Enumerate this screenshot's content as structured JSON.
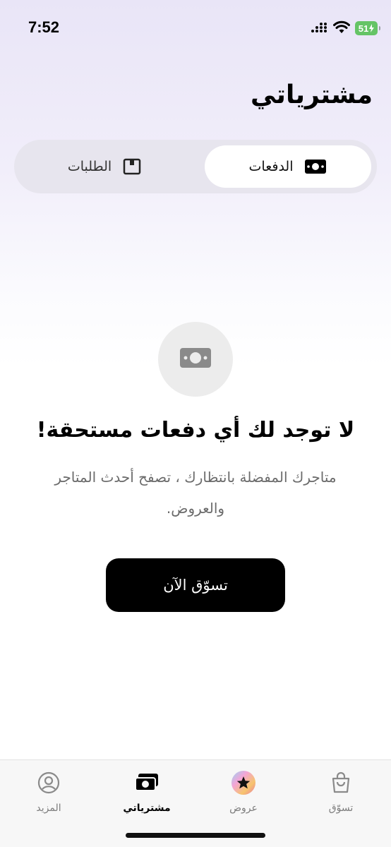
{
  "status_bar": {
    "time": "7:52",
    "battery": "51"
  },
  "header": {
    "title": "مشترياتي"
  },
  "segments": [
    {
      "label": "الدفعات",
      "icon": "cash-icon",
      "active": true
    },
    {
      "label": "الطلبات",
      "icon": "box-icon",
      "active": false
    }
  ],
  "empty_state": {
    "icon": "cash-icon",
    "title": "لا توجد لك أي دفعات مستحقة!",
    "description": "متاجرك المفضلة بانتظارك ، تصفح أحدث المتاجر والعروض.",
    "button_label": "تسوّق الآن"
  },
  "tab_bar": {
    "items": [
      {
        "label": "تسوّق",
        "icon": "shopping-bag-icon",
        "active": false
      },
      {
        "label": "عروض",
        "icon": "star-badge-icon",
        "active": false
      },
      {
        "label": "مشترياتي",
        "icon": "cash-stack-icon",
        "active": true
      },
      {
        "label": "المزيد",
        "icon": "profile-icon",
        "active": false
      }
    ]
  },
  "colors": {
    "accent": "#000000",
    "battery": "#65c466",
    "background_top": "#e9e5f7"
  }
}
